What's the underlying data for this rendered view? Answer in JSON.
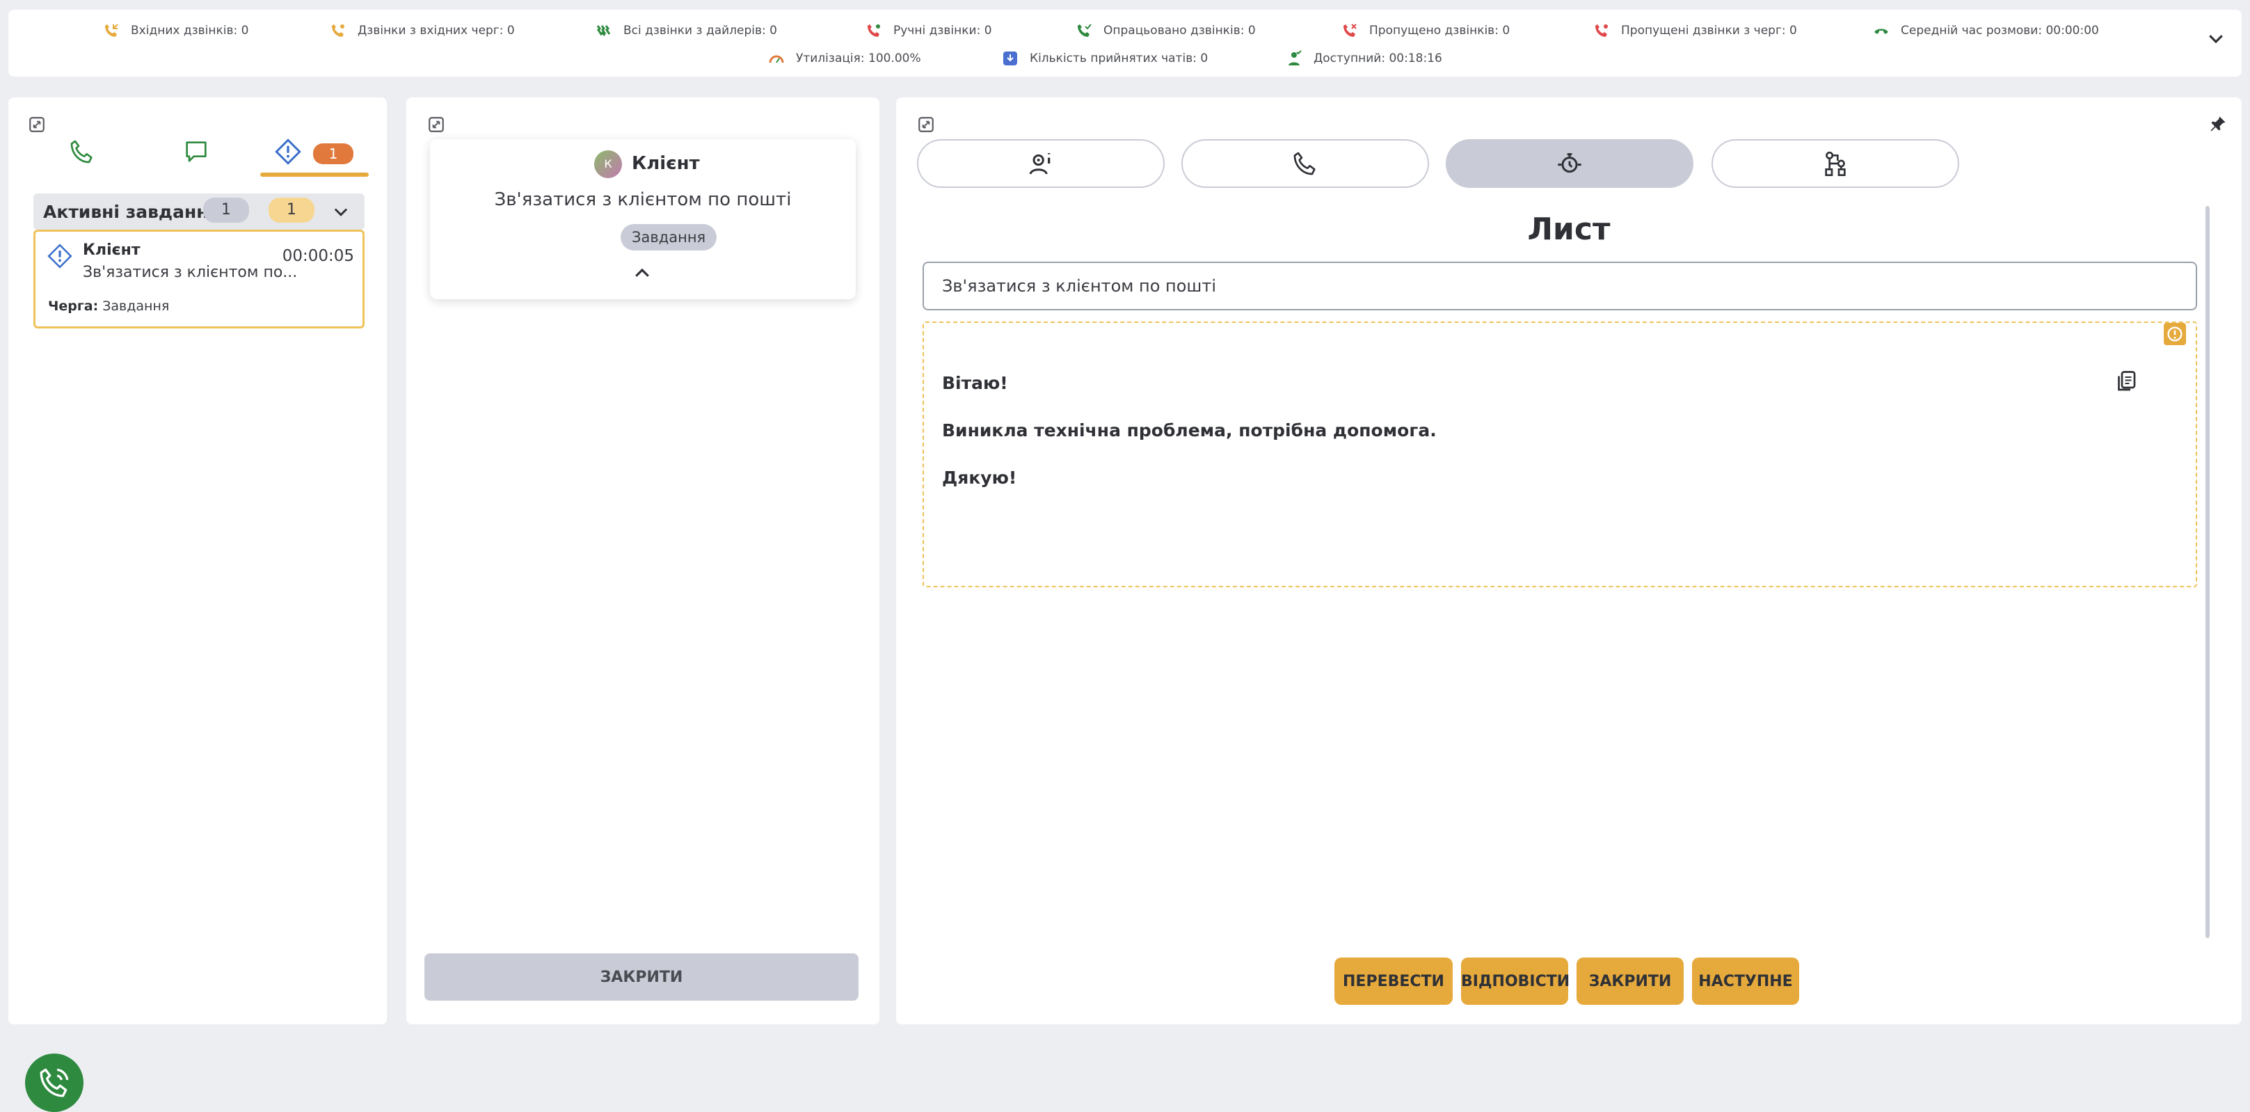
{
  "stats": {
    "incoming": "Вхідних дзвінків: 0",
    "queue_incoming": "Дзвінки з вхідних черг: 0",
    "dialer_all": "Всі дзвінки з дайлерів: 0",
    "manual": "Ручні дзвінки: 0",
    "processed": "Опрацьовано дзвінків: 0",
    "missed": "Пропущено дзвінків: 0",
    "missed_queue": "Пропущені дзвінки з черг: 0",
    "avg_talk": "Середній час розмови: 00:00:00",
    "utilization": "Утилізація: 100.00%",
    "chats_accepted": "Кількість прийнятих чатів: 0",
    "available": "Доступний: 00:18:16"
  },
  "left": {
    "tasks_badge": "1",
    "active_header": "Активні завдання",
    "active_count_gray": "1",
    "active_count_yellow": "1",
    "task": {
      "name": "Клієнт",
      "description": "Зв'язатися з клієнтом по...",
      "time": "00:00:05",
      "queue_label": "Черга:",
      "queue_value": "Завдання"
    }
  },
  "middle": {
    "avatar_letter": "К",
    "contact_name": "Клієнт",
    "subject": "Зв'язатися з клієнтом по пошті",
    "tag": "Завдання",
    "close_button": "ЗАКРИТИ"
  },
  "right": {
    "title": "Лист",
    "subject_value": "Зв'язатися з клієнтом по пошті",
    "body_lines": [
      "Вітаю!",
      "Виникла технічна проблема, потрібна допомога.",
      "Дякую!"
    ],
    "buttons": {
      "forward": "ПЕРЕВЕСТИ",
      "reply": "ВІДПОВІСТИ",
      "close": "ЗАКРИТИ",
      "next": "НАСТУПНЕ"
    }
  },
  "colors": {
    "accent": "#e6a93c",
    "badge": "#e0793b",
    "green": "#2e8a3e",
    "phone_red": "#e0484a",
    "chip_gray": "#c9ccd6"
  }
}
